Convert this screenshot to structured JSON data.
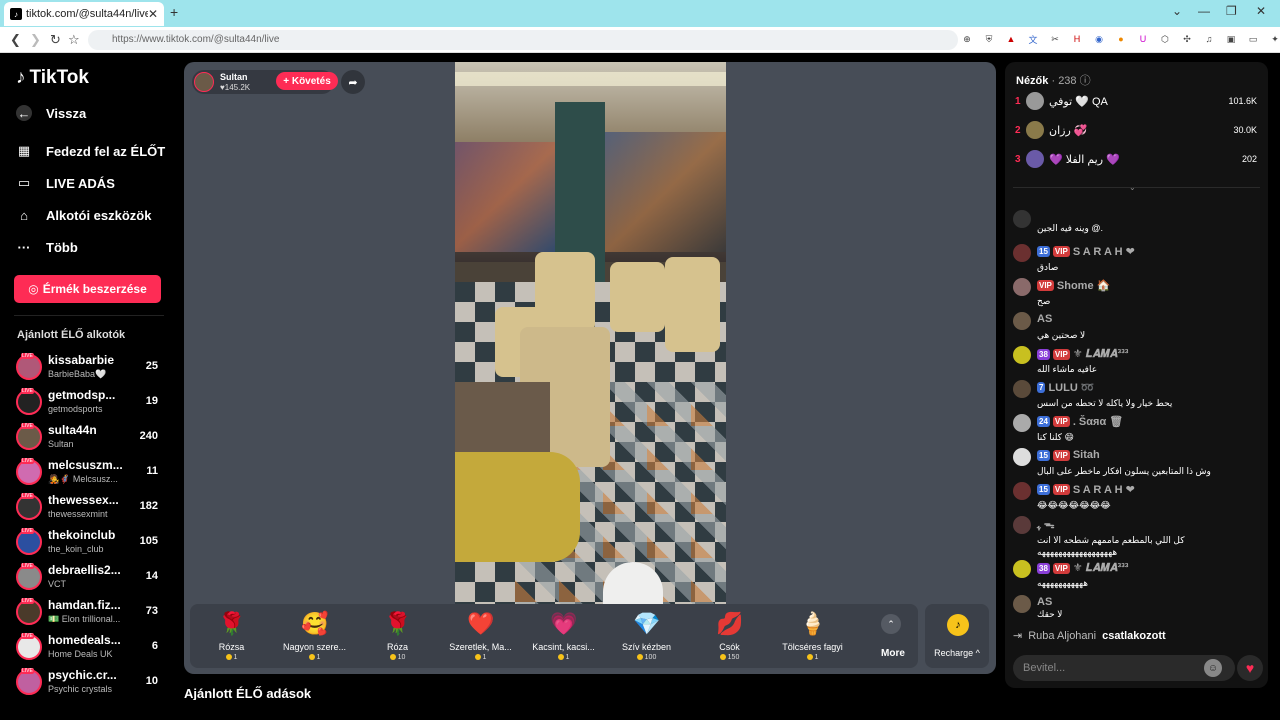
{
  "browser": {
    "tab_title": "tiktok.com/@sulta44n/live",
    "url": "https://www.tiktok.com/@sulta44n/live"
  },
  "sidebar": {
    "logo": "TikTok",
    "back": "Vissza",
    "nav": [
      "Fedezd fel az ÉLŐT",
      "LIVE ADÁS",
      "Alkotói eszközök",
      "Több"
    ],
    "coins_button": "Érmék beszerzése",
    "section_title": "Ajánlott ÉLŐ alkotók",
    "creators": [
      {
        "name": "kissabarbie",
        "sub": "BarbieBaba🤍",
        "count": "25"
      },
      {
        "name": "getmodsp...",
        "sub": "getmodsports",
        "count": "19"
      },
      {
        "name": "sulta44n",
        "sub": "Sultan",
        "count": "240"
      },
      {
        "name": "melcsuszm...",
        "sub": "🧑‍🎤🦸 Melcsusz...",
        "count": "11"
      },
      {
        "name": "thewessex...",
        "sub": "thewessexmint",
        "count": "182"
      },
      {
        "name": "thekoinclub",
        "sub": "the_koin_club",
        "count": "105"
      },
      {
        "name": "debraellis2...",
        "sub": "VCT",
        "count": "14"
      },
      {
        "name": "hamdan.fiz...",
        "sub": "💵 Elon trillional...",
        "count": "73"
      },
      {
        "name": "homedeals...",
        "sub": "Home Deals UK",
        "count": "6"
      },
      {
        "name": "psychic.cr...",
        "sub": "Psychic crystals",
        "count": "10"
      }
    ]
  },
  "host": {
    "name": "Sultan",
    "likes": "145.2K",
    "follow_label": "+ Követés"
  },
  "gifts": [
    {
      "icon": "🌹",
      "name": "Rózsa",
      "price": "1"
    },
    {
      "icon": "🥰",
      "name": "Nagyon szere...",
      "price": "1"
    },
    {
      "icon": "🌹",
      "name": "Róza",
      "price": "10"
    },
    {
      "icon": "❤️",
      "name": "Szeretlek, Ma...",
      "price": "1"
    },
    {
      "icon": "💗",
      "name": "Kacsint, kacsi...",
      "price": "1"
    },
    {
      "icon": "💎",
      "name": "Szív kézben",
      "price": "100"
    },
    {
      "icon": "💋",
      "name": "Csók",
      "price": "150"
    },
    {
      "icon": "🍦",
      "name": "Tölcséres fagyi",
      "price": "1"
    }
  ],
  "more_label": "More",
  "recharge_label": "Recharge ^",
  "bottom_title": "Ajánlott ÉLŐ adások",
  "chat": {
    "viewers_label": "Nézők",
    "viewers_count": "· 238",
    "top_viewers": [
      {
        "rank": "1",
        "name": "توفي 🤍 QA",
        "score": "101.6K"
      },
      {
        "rank": "2",
        "name": "رزان 💞",
        "score": "30.0K"
      },
      {
        "rank": "3",
        "name": "💜 ريم الفلا 💜",
        "score": "202"
      }
    ],
    "messages": [
      {
        "user": "",
        "badges": [],
        "text": "وينه فيه الجين @."
      },
      {
        "user": "S A R A H ❤",
        "badges": [
          "15",
          "VIP"
        ],
        "text": "صادق"
      },
      {
        "user": "Shome 🏠",
        "badges": [
          "VIP"
        ],
        "text": "صح"
      },
      {
        "user": "AS",
        "badges": [],
        "text": "لا صحتين هي"
      },
      {
        "user": "⚜ 𝑳𝑨𝑴𝑨³³³",
        "badges": [
          "38",
          "VIP"
        ],
        "text": "عافيه ماشاء الله"
      },
      {
        "user": "LULU ➿",
        "badges": [
          "7"
        ],
        "text": "يحط خيار ولا ياكله لا تحطه من اسس"
      },
      {
        "user": ". Šαяα 🗑",
        "badges": [
          "24",
          "VIP"
        ],
        "text": "كلنا كنا 😄"
      },
      {
        "user": "Sitah",
        "badges": [
          "15",
          "VIP"
        ],
        "text": "وش ذا المتابعين يسلون افكار ماخطر على البال"
      },
      {
        "user": "S A R A H ❤",
        "badges": [
          "15",
          "VIP"
        ],
        "text": "😂😂😂😂😂😂😂"
      },
      {
        "user": "ﮩ ᯓ",
        "badges": [],
        "text": "كل اللي بالمطعم ماممهم شطحه الا انت ههههههههههههههههههه"
      },
      {
        "user": "⚜ 𝑳𝑨𝑴𝑨³³³",
        "badges": [
          "38",
          "VIP"
        ],
        "text": "هههههههههههه"
      },
      {
        "user": "AS",
        "badges": [],
        "text": "لا حقك"
      }
    ],
    "joined_user": "Ruba Aljohani",
    "joined_text": "csatlakozott",
    "input_placeholder": "Bevitel..."
  }
}
